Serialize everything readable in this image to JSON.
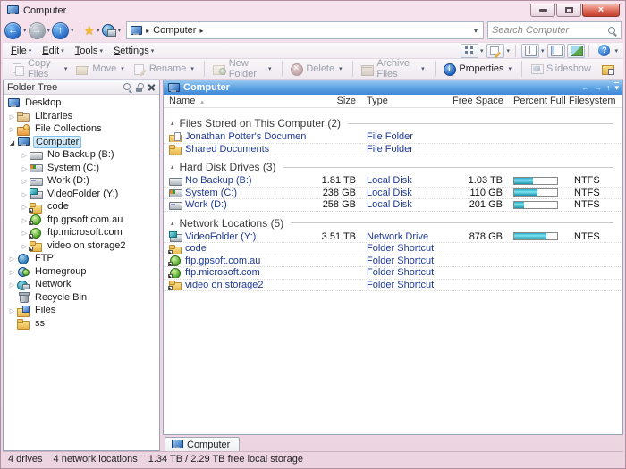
{
  "window": {
    "title": "Computer",
    "controls": {
      "minimize": "minimize",
      "maximize": "maximize",
      "close": "close"
    }
  },
  "address_bar": {
    "breadcrumb": "Computer"
  },
  "search": {
    "placeholder": "Search Computer"
  },
  "menu_bar": {
    "items": [
      {
        "label": "File"
      },
      {
        "label": "Edit"
      },
      {
        "label": "Tools"
      },
      {
        "label": "Settings"
      }
    ]
  },
  "action_toolbar": {
    "buttons": [
      {
        "label": "Copy Files",
        "icon": "copy",
        "enabled": false,
        "dropdown": true,
        "sep_after": false
      },
      {
        "label": "Move",
        "icon": "move",
        "enabled": false,
        "dropdown": true,
        "sep_after": false
      },
      {
        "label": "Rename",
        "icon": "rename",
        "enabled": false,
        "dropdown": true,
        "sep_after": true
      },
      {
        "label": "New Folder",
        "icon": "newfolder",
        "enabled": false,
        "dropdown": true,
        "sep_after": true
      },
      {
        "label": "Delete",
        "icon": "delete",
        "enabled": false,
        "dropdown": true,
        "sep_after": true
      },
      {
        "label": "Archive Files",
        "icon": "archive",
        "enabled": false,
        "dropdown": true,
        "sep_after": true
      },
      {
        "label": "Properties",
        "icon": "props",
        "enabled": true,
        "dropdown": true,
        "sep_after": true
      },
      {
        "label": "Slideshow",
        "icon": "slideshow",
        "enabled": false,
        "dropdown": false,
        "sep_after": false
      }
    ]
  },
  "folder_tree": {
    "title": "Folder Tree",
    "items": [
      {
        "label": "Desktop",
        "level": 0,
        "expander": "none",
        "no_slot": true,
        "icon": "monitor",
        "selected": false
      },
      {
        "label": "Libraries",
        "level": 0,
        "expander": "c",
        "icon": "lib",
        "selected": false
      },
      {
        "label": "File Collections",
        "level": 0,
        "expander": "c",
        "icon": "collections",
        "selected": false
      },
      {
        "label": "Computer",
        "level": 0,
        "expander": "e",
        "icon": "monitor",
        "selected": true
      },
      {
        "label": "No Backup (B:)",
        "level": 1,
        "expander": "c",
        "icon": "drive",
        "selected": false
      },
      {
        "label": "System (C:)",
        "level": 1,
        "expander": "c",
        "icon": "drive-sys",
        "selected": false
      },
      {
        "label": "Work (D:)",
        "level": 1,
        "expander": "c",
        "icon": "drive-work",
        "selected": false
      },
      {
        "label": "VideoFolder (Y:)",
        "level": 1,
        "expander": "c",
        "icon": "netdrive",
        "selected": false
      },
      {
        "label": "code",
        "level": 1,
        "expander": "c",
        "icon": "folder",
        "link": true,
        "selected": false
      },
      {
        "label": "ftp.gpsoft.com.au",
        "level": 1,
        "expander": "c",
        "icon": "ftp",
        "link": true,
        "selected": false
      },
      {
        "label": "ftp.microsoft.com",
        "level": 1,
        "expander": "c",
        "icon": "ftp",
        "link": true,
        "selected": false
      },
      {
        "label": "video on storage2",
        "level": 1,
        "expander": "c",
        "icon": "folder",
        "link": true,
        "selected": false
      },
      {
        "label": "FTP",
        "level": 0,
        "expander": "c",
        "icon": "globe",
        "selected": false
      },
      {
        "label": "Homegroup",
        "level": 0,
        "expander": "c",
        "icon": "homegroup",
        "selected": false
      },
      {
        "label": "Network",
        "level": 0,
        "expander": "c",
        "icon": "network",
        "selected": false
      },
      {
        "label": "Recycle Bin",
        "level": 0,
        "expander": "none",
        "icon": "recycle",
        "selected": false
      },
      {
        "label": "Files",
        "level": 0,
        "expander": "c",
        "icon": "files",
        "selected": false
      },
      {
        "label": "ss",
        "level": 0,
        "expander": "none",
        "icon": "folder",
        "selected": false
      }
    ]
  },
  "file_panel": {
    "header_title": "Computer",
    "columns": [
      {
        "label": "Name",
        "align": "left",
        "sorted": true
      },
      {
        "label": "Size",
        "align": "right",
        "sorted": false
      },
      {
        "label": "Type",
        "align": "left",
        "sorted": false
      },
      {
        "label": "Free Space",
        "align": "right",
        "sorted": false
      },
      {
        "label": "Percent Full",
        "align": "left",
        "sorted": false
      },
      {
        "label": "Filesystem",
        "align": "left",
        "sorted": false
      }
    ],
    "groups": [
      {
        "title": "Files Stored on This Computer (2)",
        "items": [
          {
            "name": "Jonathan Potter's Documents",
            "icon": "folder-docs",
            "size": "",
            "type": "File Folder",
            "free": "",
            "percent_full": null,
            "fs": ""
          },
          {
            "name": "Shared Documents",
            "icon": "folder",
            "size": "",
            "type": "File Folder",
            "free": "",
            "percent_full": null,
            "fs": ""
          }
        ]
      },
      {
        "title": "Hard Disk Drives (3)",
        "items": [
          {
            "name": "No Backup (B:)",
            "icon": "drive",
            "size": "1.81 TB",
            "type": "Local Disk",
            "free": "1.03 TB",
            "percent_full": 43,
            "fs": "NTFS"
          },
          {
            "name": "System (C:)",
            "icon": "drive-sys",
            "size": "238 GB",
            "type": "Local Disk",
            "free": "110 GB",
            "percent_full": 54,
            "fs": "NTFS"
          },
          {
            "name": "Work (D:)",
            "icon": "drive-work",
            "size": "258 GB",
            "type": "Local Disk",
            "free": "201 GB",
            "percent_full": 22,
            "fs": "NTFS"
          }
        ]
      },
      {
        "title": "Network Locations (5)",
        "items": [
          {
            "name": "VideoFolder (Y:)",
            "icon": "netdrive",
            "size": "3.51 TB",
            "type": "Network Drive",
            "free": "878 GB",
            "percent_full": 75,
            "fs": "NTFS"
          },
          {
            "name": "code",
            "icon": "folder",
            "link": true,
            "size": "",
            "type": "Folder Shortcut",
            "free": "",
            "percent_full": null,
            "fs": ""
          },
          {
            "name": "ftp.gpsoft.com.au",
            "icon": "ftp",
            "link": true,
            "size": "",
            "type": "Folder Shortcut",
            "free": "",
            "percent_full": null,
            "fs": ""
          },
          {
            "name": "ftp.microsoft.com",
            "icon": "ftp",
            "link": true,
            "size": "",
            "type": "Folder Shortcut",
            "free": "",
            "percent_full": null,
            "fs": ""
          },
          {
            "name": "video on storage2",
            "icon": "folder",
            "link": true,
            "size": "",
            "type": "Folder Shortcut",
            "free": "",
            "percent_full": null,
            "fs": ""
          }
        ]
      }
    ]
  },
  "tab_bar": {
    "tabs": [
      {
        "label": "Computer",
        "active": true
      }
    ]
  },
  "status_bar": {
    "segments": [
      "4 drives",
      "4 network locations",
      "1.34 TB / 2.29 TB free local storage"
    ]
  },
  "colors": {
    "header_blue": "#3e88d6",
    "bar_teal": "#23aec8",
    "name_navy": "#1f3a93",
    "selection_blue": "#c0e2f6",
    "frame_pink": "#f6e2ec"
  }
}
